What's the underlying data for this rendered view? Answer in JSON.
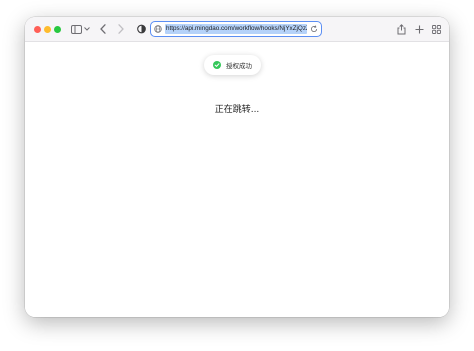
{
  "browser": {
    "url": "https://api.mingdao.com/workflow/hooks/NjYxZjQzZl",
    "icons": {
      "sidebar": "sidebar-icon",
      "back": "chevron-left-icon",
      "forward": "chevron-right-icon",
      "privacy": "shield-icon",
      "share": "share-icon",
      "new_tab": "plus-icon",
      "tab_overview": "grid-icon",
      "site": "globe-icon",
      "reload": "reload-icon"
    }
  },
  "toast": {
    "text": "授权成功",
    "icon": "check-circle-icon",
    "icon_color": "#34c759"
  },
  "page": {
    "status_text": "正在跳转..."
  },
  "colors": {
    "accent": "#5b8ef3",
    "url_selection": "#b5d2f9"
  }
}
